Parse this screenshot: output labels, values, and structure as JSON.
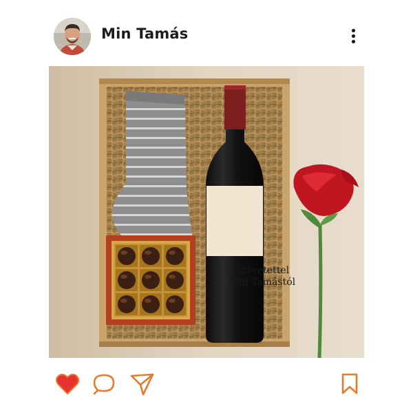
{
  "post": {
    "author": {
      "name": "Min Tamás",
      "avatar_icon": "profile-photo"
    },
    "menu_icon": "more-vertical-icon",
    "image": {
      "bottle_label": {
        "line1": "Szeretettel",
        "line2": "Min Tamástól"
      }
    },
    "actions": {
      "like": {
        "icon": "heart-icon",
        "state": "liked",
        "color": "#e8322f"
      },
      "comment": {
        "icon": "comment-icon"
      },
      "share": {
        "icon": "send-icon"
      },
      "save": {
        "icon": "bookmark-icon"
      }
    },
    "accent_color": "#ea7a2a"
  }
}
